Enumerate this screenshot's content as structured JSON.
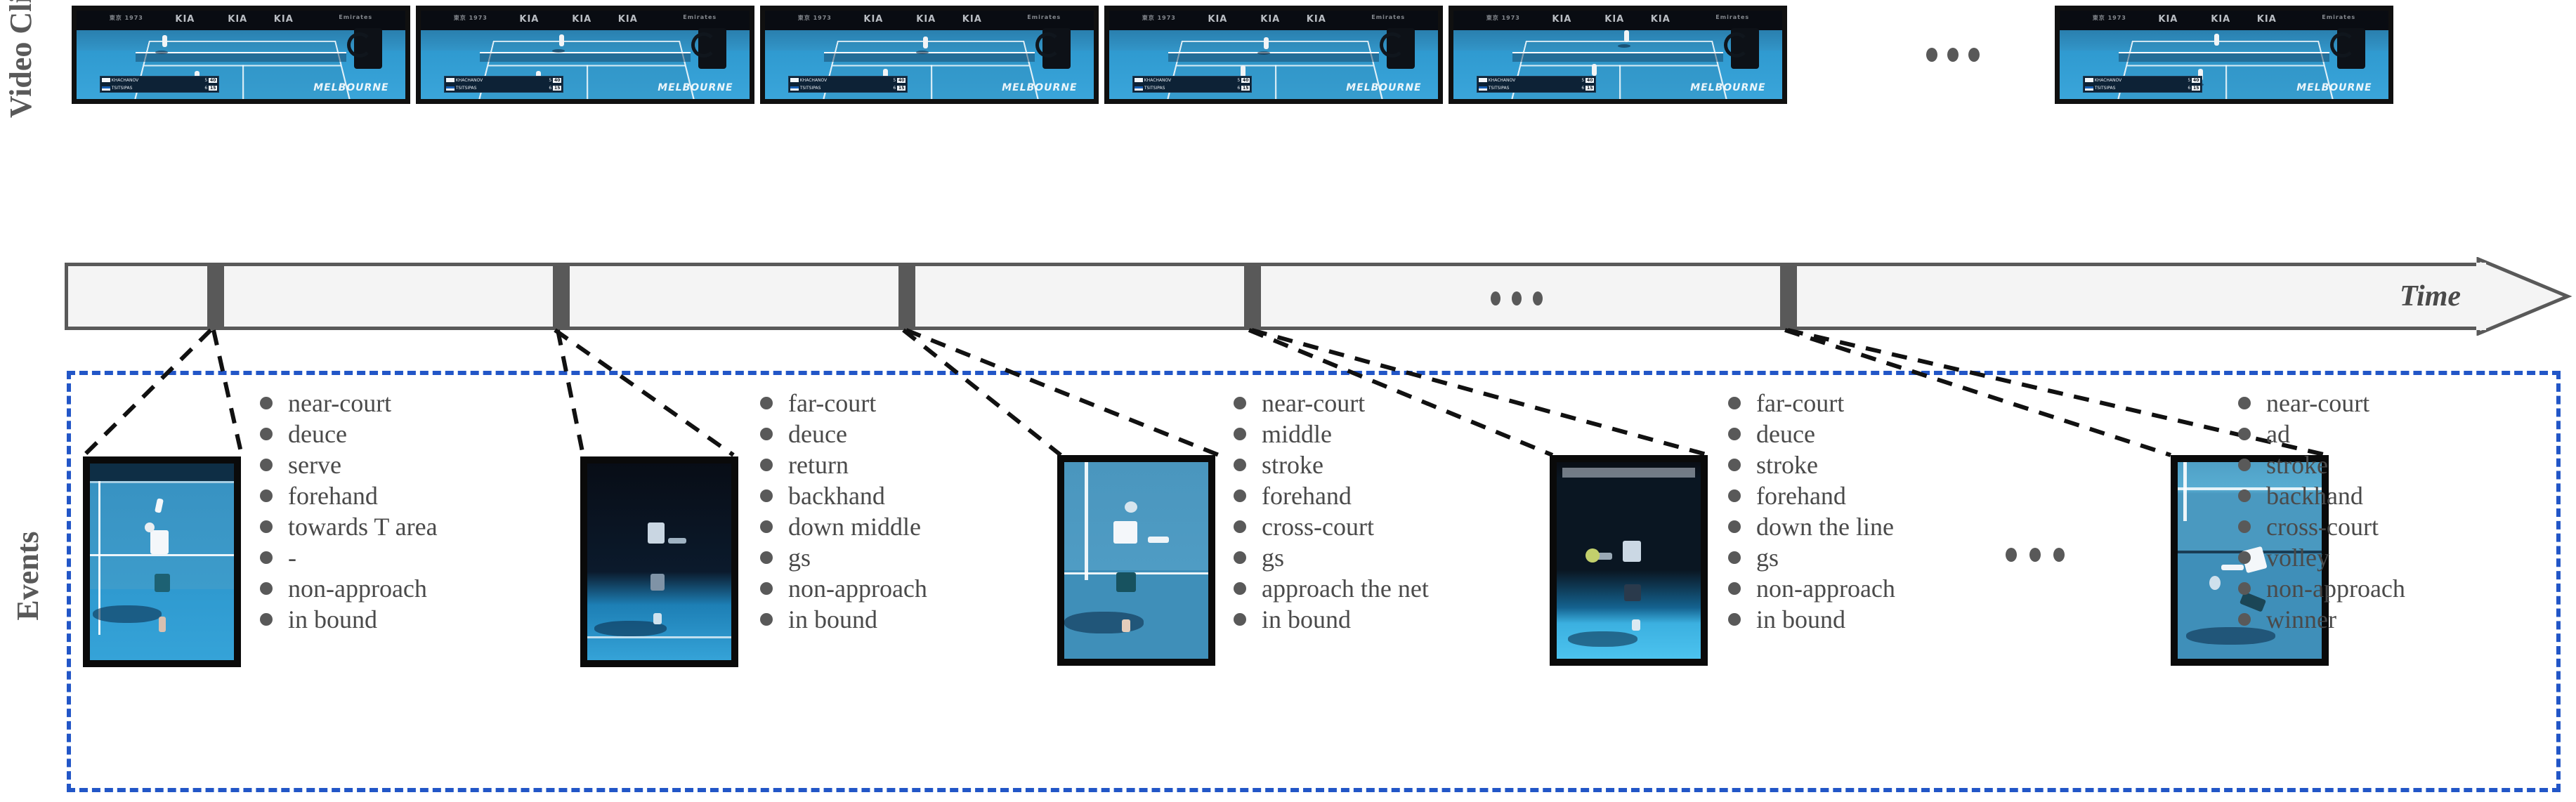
{
  "labels": {
    "video_clip": "Video Clip",
    "events": "Events",
    "time": "Time"
  },
  "ellipsis": "•••",
  "colors": {
    "events_box_border": "#2256c7",
    "timeline_fill": "#f4f4f4",
    "timeline_border": "#595959",
    "marker": "#595959",
    "text": "#4a4a4a",
    "frame_border": "#101010"
  },
  "video_clip": {
    "frames": [
      {
        "id": "frame-1",
        "scoreboard": {
          "p1_name": "KHACHANOV",
          "p1_sets": "5",
          "p1_points": "40",
          "p2_name": "TSITSIPAS",
          "p2_sets": "6",
          "p2_points": "15"
        },
        "venue": "MELBOURNE",
        "sponsor": "KIA"
      },
      {
        "id": "frame-2",
        "scoreboard": {
          "p1_name": "KHACHANOV",
          "p1_sets": "5",
          "p1_points": "40",
          "p2_name": "TSITSIPAS",
          "p2_sets": "6",
          "p2_points": "15"
        },
        "venue": "MELBOURNE",
        "sponsor": "KIA"
      },
      {
        "id": "frame-3",
        "scoreboard": {
          "p1_name": "KHACHANOV",
          "p1_sets": "5",
          "p1_points": "40",
          "p2_name": "TSITSIPAS",
          "p2_sets": "6",
          "p2_points": "15"
        },
        "venue": "MELBOURNE",
        "sponsor": "KIA"
      },
      {
        "id": "frame-4",
        "scoreboard": {
          "p1_name": "KHACHANOV",
          "p1_sets": "5",
          "p1_points": "40",
          "p2_name": "TSITSIPAS",
          "p2_sets": "6",
          "p2_points": "15"
        },
        "venue": "MELBOURNE",
        "sponsor": "KIA"
      },
      {
        "id": "frame-5",
        "scoreboard": {
          "p1_name": "KHACHANOV",
          "p1_sets": "5",
          "p1_points": "40",
          "p2_name": "TSITSIPAS",
          "p2_sets": "6",
          "p2_points": "15"
        },
        "venue": "MELBOURNE",
        "sponsor": "KIA"
      },
      {
        "id": "frame-6",
        "scoreboard": {
          "p1_name": "KHACHANOV",
          "p1_sets": "5",
          "p1_points": "40",
          "p2_name": "TSITSIPAS",
          "p2_sets": "6",
          "p2_points": "15"
        },
        "venue": "MELBOURNE",
        "sponsor": "KIA"
      }
    ]
  },
  "timeline": {
    "markers": 5,
    "time_label": "Time"
  },
  "events": {
    "groups": [
      {
        "id": "event-1",
        "attributes": [
          "near-court",
          "deuce",
          "serve",
          "forehand",
          "towards T area",
          "-",
          "non-approach",
          "in bound"
        ]
      },
      {
        "id": "event-2",
        "attributes": [
          "far-court",
          "deuce",
          "return",
          "backhand",
          "down middle",
          "gs",
          "non-approach",
          "in bound"
        ]
      },
      {
        "id": "event-3",
        "attributes": [
          "near-court",
          "middle",
          "stroke",
          "forehand",
          "cross-court",
          "gs",
          "approach the net",
          "in bound"
        ]
      },
      {
        "id": "event-4",
        "attributes": [
          "far-court",
          "deuce",
          "stroke",
          "forehand",
          "down the line",
          "gs",
          "non-approach",
          "in bound"
        ]
      },
      {
        "id": "event-5",
        "attributes": [
          "near-court",
          "ad",
          "stroke",
          "backhand",
          "cross-court",
          "volley",
          "non-approach",
          "winner"
        ]
      }
    ]
  }
}
